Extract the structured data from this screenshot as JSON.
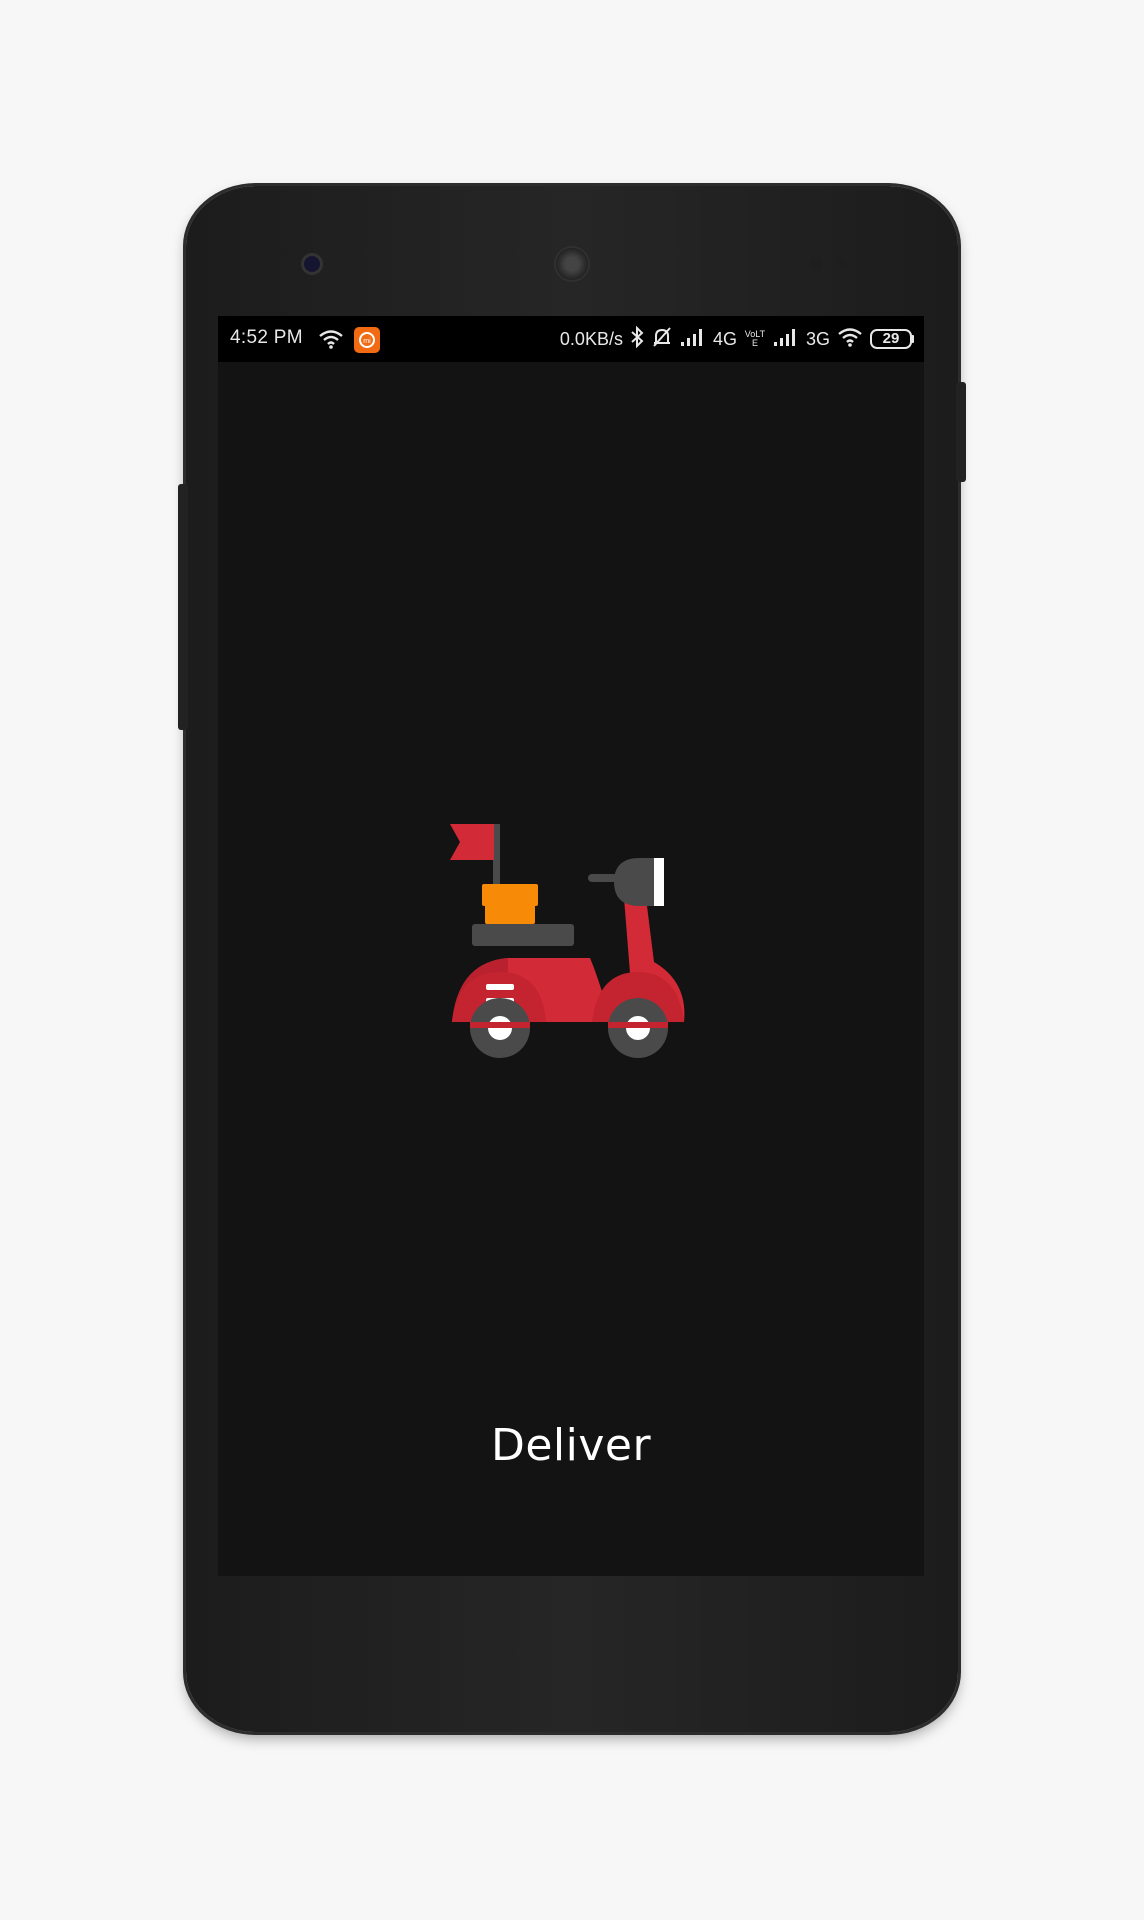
{
  "status_bar": {
    "time": "4:52 PM",
    "net_speed": "0.0KB/s",
    "network_4g": "4G",
    "network_3g": "3G",
    "volte": "VoLTE",
    "battery": "29"
  },
  "splash": {
    "app_name": "Deliver",
    "logo_icon": "delivery-scooter-icon"
  },
  "colors": {
    "background": "#131313",
    "scooter_red": "#d32a37",
    "box_orange": "#f78a06",
    "seat_gray": "#4a4a4a",
    "app_name_text": "#ffffff"
  }
}
